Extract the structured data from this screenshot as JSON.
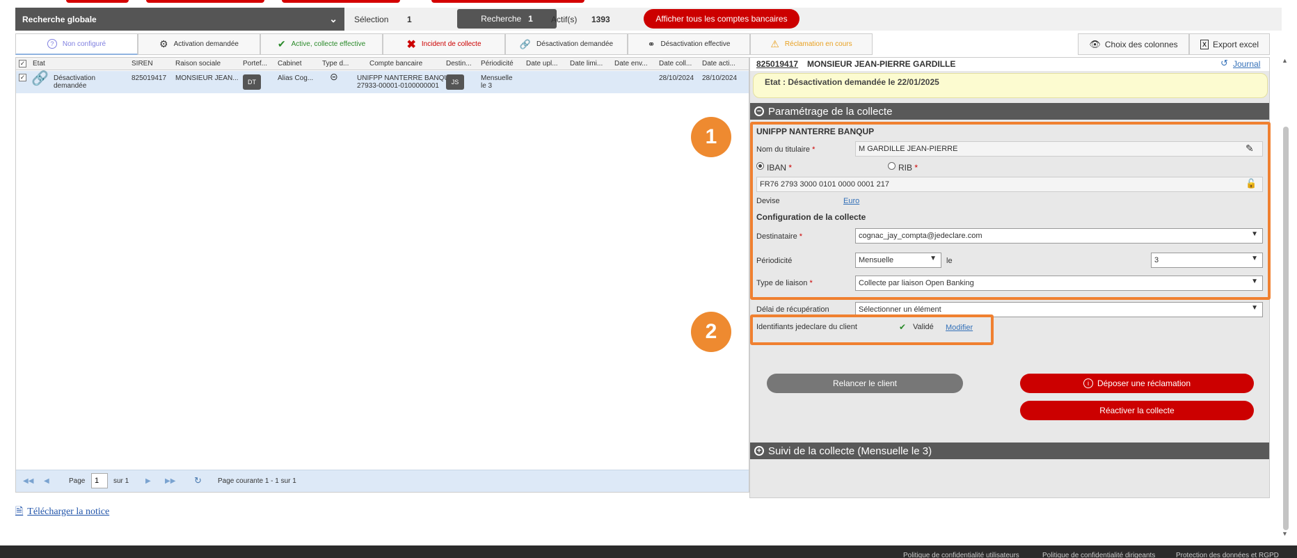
{
  "toolbar": {
    "global_search": "Recherche globale",
    "selection_label": "Sélection",
    "selection_count": "1",
    "search_label": "Recherche",
    "search_count": "1",
    "active_label": "Actif(s)",
    "active_count": "1393",
    "show_all_label": "Afficher tous les comptes bancaires"
  },
  "tabs": [
    {
      "label": "Non configuré",
      "icon": "question-circle-icon",
      "color": "#8080e0"
    },
    {
      "label": "Activation demandée",
      "icon": "gear-icon",
      "color": "#333333"
    },
    {
      "label": "Active, collecte effective",
      "icon": "check-icon",
      "color": "#2a8a2a"
    },
    {
      "label": "Incident de collecte",
      "icon": "cross-icon",
      "color": "#cc0000"
    },
    {
      "label": "Désactivation demandée",
      "icon": "link-icon",
      "color": "#333333"
    },
    {
      "label": "Désactivation effective",
      "icon": "broken-link-icon",
      "color": "#333333"
    },
    {
      "label": "Réclamation en cours",
      "icon": "warning-icon",
      "color": "#e8a020"
    }
  ],
  "tools": {
    "columns": "Choix des colonnes",
    "export": "Export excel"
  },
  "grid": {
    "headers": [
      "Etat",
      "SIREN",
      "Raison sociale",
      "Portef...",
      "Cabinet",
      "Type d...",
      "Compte bancaire",
      "Destin...",
      "Périodicité",
      "Date upl...",
      "Date limi...",
      "Date env...",
      "Date coll...",
      "Date acti..."
    ],
    "row": {
      "etat_line1": "Désactivation",
      "etat_line2": "demandée",
      "siren": "825019417",
      "raison": "MONSIEUR JEAN...",
      "portef": "DT",
      "cabinet": "Alias Cog...",
      "compte_line1": "UNIFPP NANTERRE BANQU",
      "compte_line2": "27933-00001-0100000001",
      "destin": "JS",
      "periodicite_line1": "Mensuelle",
      "periodicite_line2": "le 3",
      "date_coll": "28/10/2024",
      "date_acti": "28/10/2024"
    }
  },
  "pager": {
    "page_label": "Page",
    "page_value": "1",
    "of_label": "sur 1",
    "status": "Page courante 1 - 1 sur 1"
  },
  "notice": "Télécharger la notice",
  "panel": {
    "siren_link": "825019417",
    "client_name": "MONSIEUR JEAN-PIERRE GARDILLE",
    "journal": "Journal",
    "state": "Etat : Désactivation demandée le 22/01/2025",
    "section_params": "Paramétrage de la collecte",
    "bank_name": "UNIFPP NANTERRE BANQUP",
    "holder_label": "Nom du titulaire",
    "holder_value": "M GARDILLE JEAN-PIERRE",
    "iban_label": "IBAN",
    "rib_label": "RIB",
    "iban_value": "FR76 2793 3000 0101 0000 0001 217",
    "currency_label": "Devise",
    "currency_value": "Euro",
    "config_title": "Configuration de la collecte",
    "recipient_label": "Destinataire",
    "recipient_value": "cognac_jay_compta@jedeclare.com",
    "period_label": "Périodicité",
    "period_value": "Mensuelle",
    "period_on": "le",
    "period_day": "3",
    "link_type_label": "Type de liaison",
    "link_type_value": "Collecte par liaison Open Banking",
    "delay_label": "Délai de récupération",
    "delay_value": "Sélectionner un élément",
    "ids_label": "Identifiants jedeclare du client",
    "ids_status": "Validé",
    "ids_modify": "Modifier",
    "btn_relaunch": "Relancer le client",
    "btn_claim": "Déposer une réclamation",
    "btn_reactivate": "Réactiver la collecte",
    "section_follow": "Suivi de la collecte (Mensuelle le 3)"
  },
  "annotations": [
    "1",
    "2"
  ],
  "footer": {
    "links": [
      "Politique de confidentialité utilisateurs",
      "Politique de confidentialité dirigeants",
      "Protection des données et RGPD"
    ]
  },
  "colors": {
    "accent_red": "#cc0000",
    "annotation_orange": "#ee8a30",
    "dark_bar": "#555555"
  }
}
